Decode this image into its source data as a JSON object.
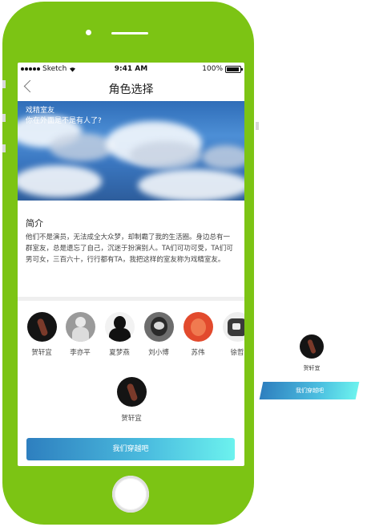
{
  "status_bar": {
    "carrier": "Sketch",
    "time": "9:41 AM",
    "battery": "100%"
  },
  "nav": {
    "title": "角色选择"
  },
  "hero": {
    "line1": "戏精室友",
    "line2": "你在外面是不是有人了?"
  },
  "intro": {
    "title": "简介",
    "body": "他们不是演员，无法成全大众梦，却制霸了我的生活圈。身边总有一群室友，总是遗忘了自己，沉迷于扮演别人。TA们可功可受，TA们可男可女，三百六十，行行都有TA，我把这样的室友称为戏精室友。"
  },
  "characters": [
    {
      "name": "贺轩宜",
      "icon": "dark-figure-avatar",
      "bg": "#141414"
    },
    {
      "name": "李亦平",
      "icon": "grey-figure-avatar",
      "bg": "#9a9a9a"
    },
    {
      "name": "夏梦燕",
      "icon": "silhouette-avatar",
      "bg": "#f2f2f2"
    },
    {
      "name": "刘小博",
      "icon": "hooded-avatar",
      "bg": "#6d6d6d"
    },
    {
      "name": "苏伟",
      "icon": "red-figure-avatar",
      "bg": "#e24a2d"
    },
    {
      "name": "徐哲",
      "icon": "robot-avatar",
      "bg": "#eeeeee"
    }
  ],
  "selected": {
    "name": "贺轩宜"
  },
  "main_button": "我们穿越吧",
  "side_widget": {
    "name": "贺轩宜",
    "button": "我们穿越吧"
  },
  "colors": {
    "phone_frame": "#7cc414",
    "button_start": "#2e7fbf",
    "button_end": "#6cf2ee"
  }
}
